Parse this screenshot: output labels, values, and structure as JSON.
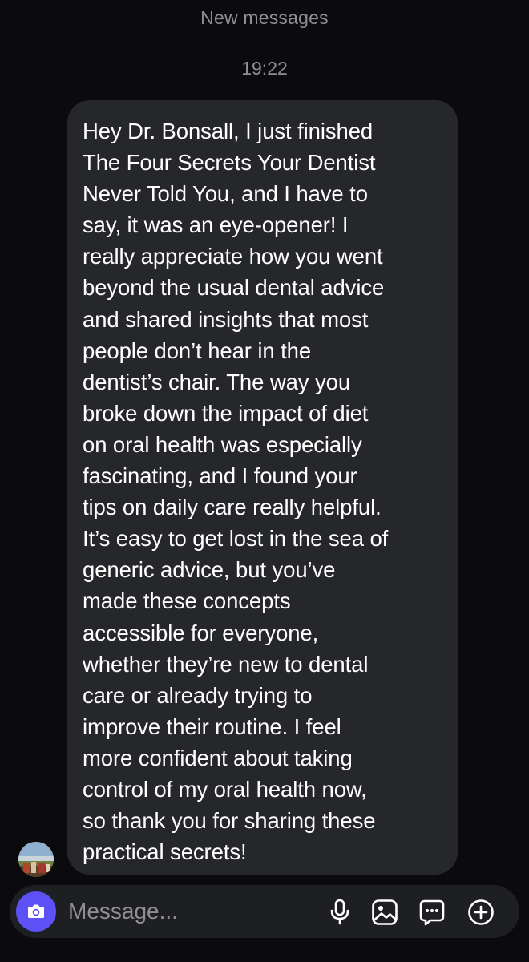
{
  "divider": {
    "label": "New messages"
  },
  "thread": {
    "timestamp": "19:22",
    "message": {
      "text": "Hey Dr. Bonsall, I just finished\nThe Four Secrets Your Dentist\nNever Told You, and I have to\nsay, it was an eye-opener! I\nreally appreciate how you went\nbeyond the usual dental advice\nand shared insights that most\npeople don’t hear in the\ndentist’s chair. The way you\nbroke down the impact of diet\non oral health was especially\nfascinating, and I found your\ntips on daily care really helpful.\nIt’s easy to get lost in the sea of\ngeneric advice, but you’ve\nmade these concepts\naccessible for everyone,\nwhether they’re new to dental\ncare or already trying to\nimprove their routine. I feel\nmore confident about taking\ncontrol of my oral health now,\nso thank you for sharing these\npractical secrets!"
    }
  },
  "composer": {
    "placeholder": "Message...",
    "icons": {
      "camera": "camera-icon",
      "mic": "microphone-icon",
      "gallery": "image-icon",
      "sticker": "sticker-icon",
      "plus": "plus-circle-icon"
    }
  },
  "colors": {
    "background": "#0b0b0e",
    "bubble": "#26272b",
    "camera_button": "#5b51f5",
    "secondary_text": "#8e8e93"
  }
}
